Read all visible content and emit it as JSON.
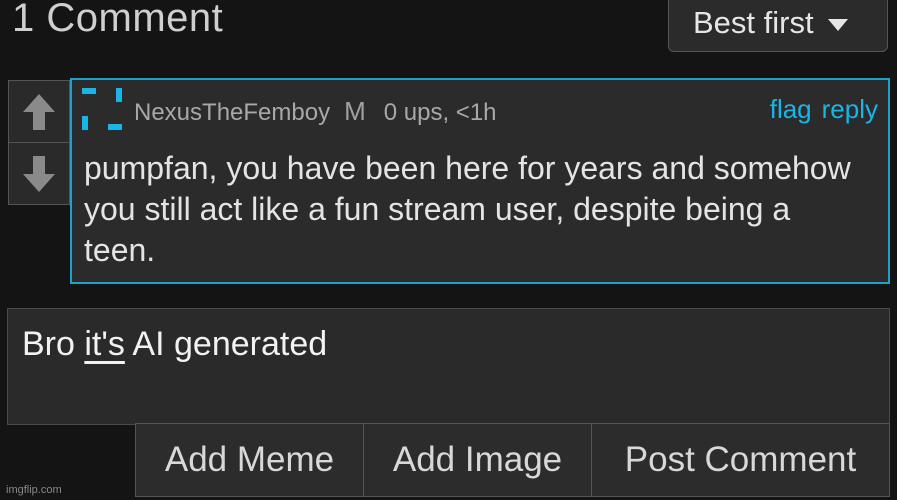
{
  "header": {
    "title": "1 Comment",
    "sort_label": "Best first"
  },
  "vote": {
    "up_icon": "arrow-up-icon",
    "down_icon": "arrow-down-icon"
  },
  "comment": {
    "author": "NexusTheFemboy",
    "gender": "M",
    "stats": "0 ups, <1h",
    "flag_label": "flag",
    "reply_label": "reply",
    "body": "pumpfan, you have been here for years and somehow you still act like a fun stream user, despite being a teen.",
    "border_color": "#1ea1c9",
    "link_color": "#19b5e6"
  },
  "reply_input": {
    "value_before": "Bro ",
    "value_underlined": "it's",
    "value_after": " AI generated"
  },
  "buttons": {
    "add_meme": "Add Meme",
    "add_image": "Add Image",
    "post_comment": "Post Comment"
  },
  "watermark": "imgflip.com"
}
